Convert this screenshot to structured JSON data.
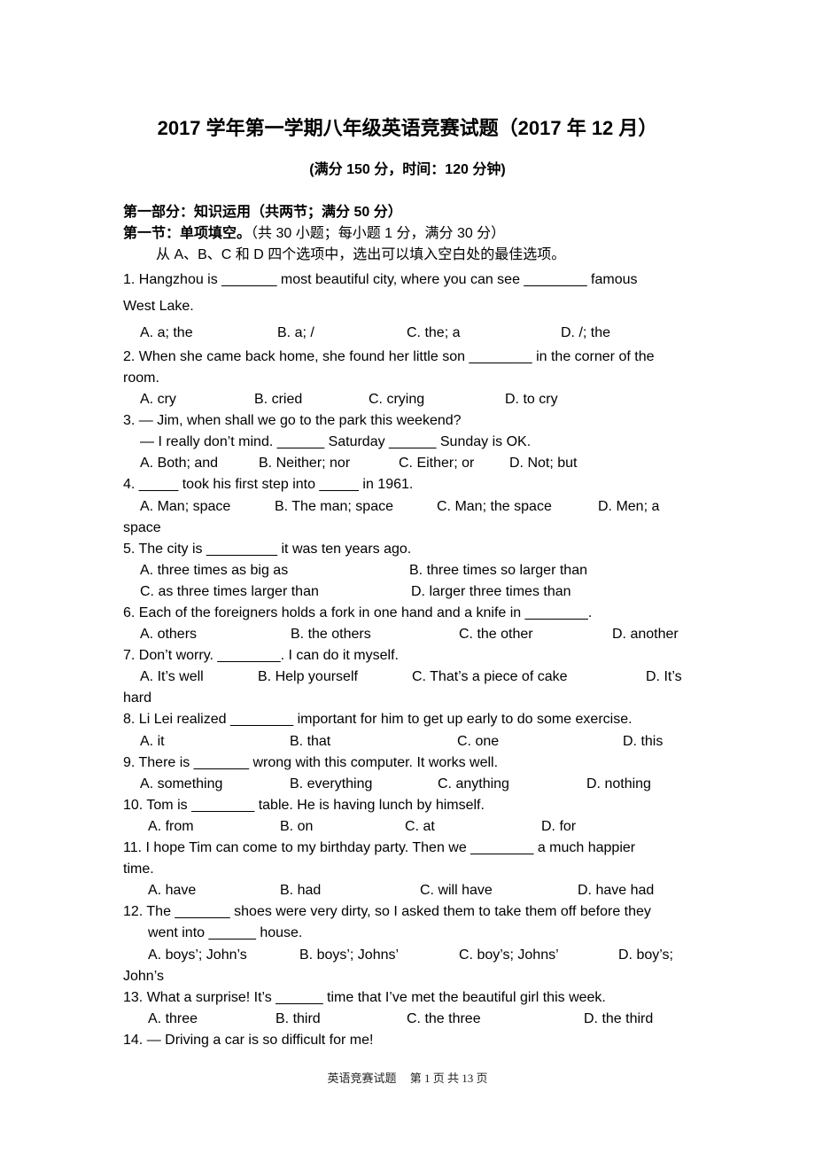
{
  "header": {
    "title": "2017 学年第一学期八年级英语竞赛试题（2017 年 12 月）",
    "subtitle": "(满分 150 分，时间：120 分钟)"
  },
  "part": {
    "heading": "第一部分：知识运用（共两节；满分 50 分）",
    "section_heading": "第一节：单项填空。",
    "section_note": "（共 30 小题；每小题 1 分，满分 30 分）",
    "instruction": "从 A、B、C 和 D 四个选项中，选出可以填入空白处的最佳选项。"
  },
  "questions": [
    {
      "lines": [
        "1. Hangzhou is _______ most beautiful city, where you can see ________ famous",
        "West Lake."
      ],
      "options": [
        "A. a; the",
        "B. a; /",
        "C. the; a",
        "D. /; the"
      ]
    },
    {
      "lines": [
        "2. When she came back home, she found her little son  ________  in the corner of the",
        "room."
      ],
      "options": [
        "A. cry",
        "B. cried",
        "C. crying",
        "D. to cry"
      ]
    },
    {
      "lines": [
        "3. — Jim, when shall we go to the park this weekend?",
        "— I really don’t mind. ______ Saturday ______ Sunday is OK."
      ],
      "options": [
        "A. Both; and",
        "B. Neither; nor",
        "C. Either; or",
        "D. Not; but"
      ]
    },
    {
      "lines": [
        "4. _____ took his first step into _____ in 1961."
      ],
      "options": [
        "A. Man; space",
        "B. The man; space",
        "C. Man; the space",
        "D. Men; a"
      ],
      "wrap": "space"
    },
    {
      "lines": [
        "5. The city is _________ it was ten years ago."
      ],
      "options": [
        "A. three times as big as",
        "B. three times so larger than",
        "C. as three times larger than",
        "D. larger three times than"
      ]
    },
    {
      "lines": [
        "6. Each of the foreigners holds a fork in one hand and a knife in  ________."
      ],
      "options": [
        "A. others",
        "B. the others",
        "C. the other",
        "D. another"
      ]
    },
    {
      "lines": [
        "7. Don’t worry. ________. I can do it myself."
      ],
      "options": [
        "A. It’s well",
        "B. Help yourself",
        "C. That’s a piece of cake",
        "D. It’s"
      ],
      "wrap": "hard"
    },
    {
      "lines": [
        "8. Li Lei realized ________ important for him to get up early to do some exercise."
      ],
      "options": [
        "A. it",
        "B. that",
        "C. one",
        "D. this"
      ]
    },
    {
      "lines": [
        "9. There is  _______  wrong with this computer. It works well."
      ],
      "options": [
        "A. something",
        "B. everything",
        "C. anything",
        "D. nothing"
      ]
    },
    {
      "lines": [
        "10. Tom is  ________  table. He is having lunch by himself."
      ],
      "options": [
        "A. from",
        "B. on",
        "C. at",
        "D. for"
      ]
    },
    {
      "lines": [
        "11. I hope Tim can come to my birthday party. Then we ________ a much happier",
        "time."
      ],
      "options": [
        "A. have",
        "B. had",
        "C. will have",
        "D. have had"
      ]
    },
    {
      "lines": [
        "12. The _______ shoes were very dirty, so I asked them to take them off before they",
        "went into ______ house."
      ],
      "options": [
        "A. boys’; John’s",
        "B. boys’; Johns’",
        "C. boy’s; Johns’",
        "D. boy’s;"
      ],
      "wrap": "John’s"
    },
    {
      "lines": [
        "13. What a surprise! It’s ______ time that I’ve met the beautiful girl this week."
      ],
      "options": [
        "A. three",
        "B. third",
        "C. the three",
        "D. the third"
      ]
    },
    {
      "lines": [
        "14. — Driving a car is so difficult for me!"
      ]
    }
  ],
  "footer": {
    "label": "英语竞赛试题",
    "page_text": "第 1 页 共 13 页"
  }
}
